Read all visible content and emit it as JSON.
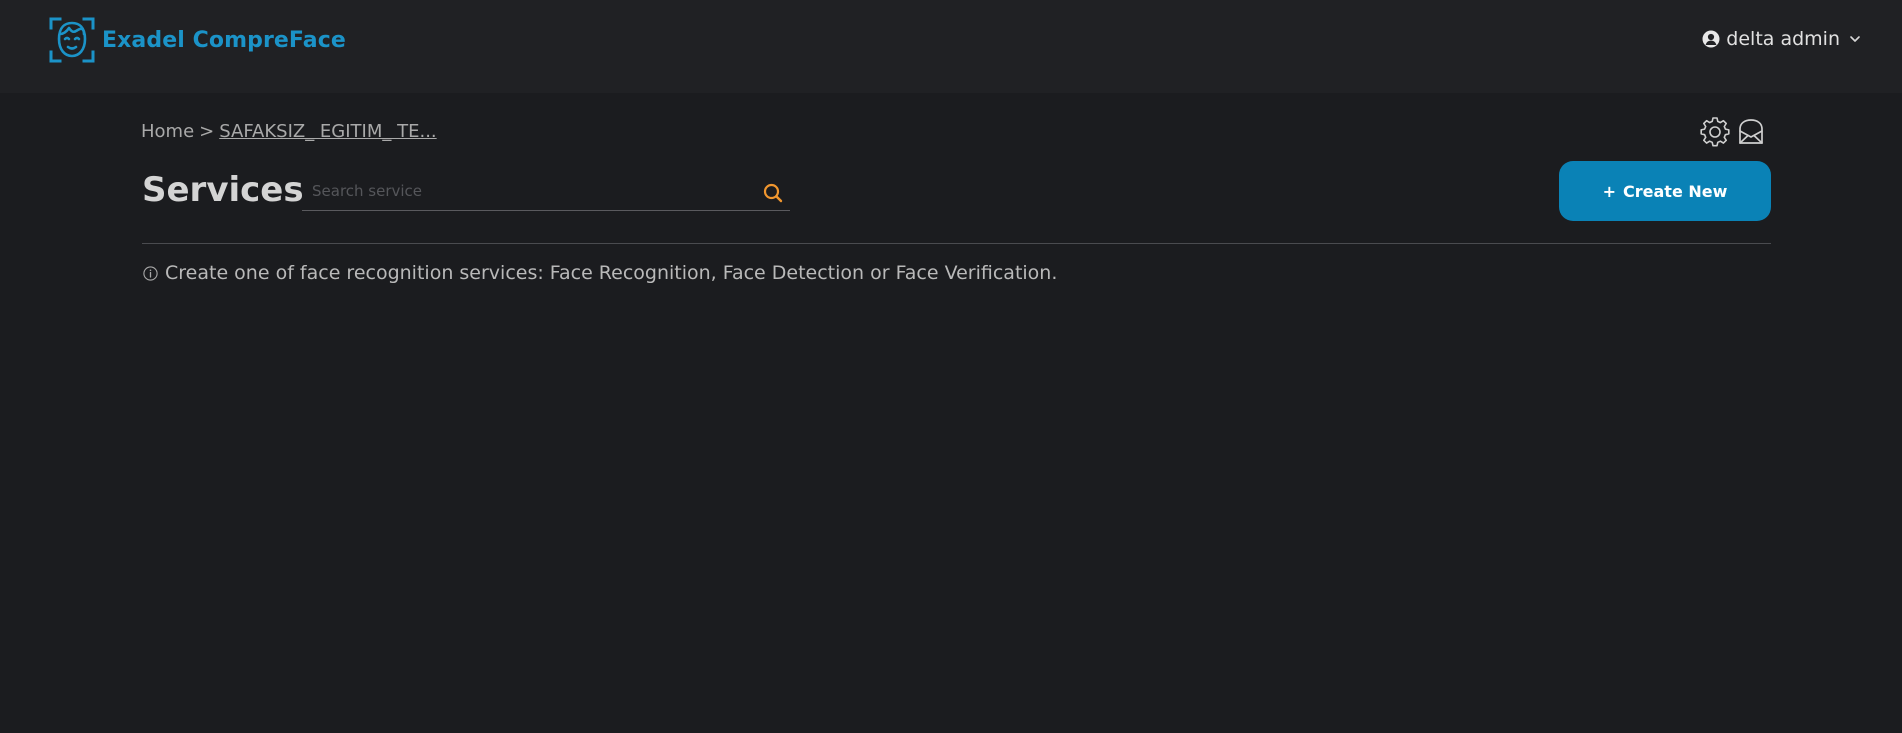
{
  "header": {
    "brand": "Exadel CompreFace",
    "logo_icon": "face-scan-icon",
    "user_name": "delta admin",
    "user_icon": "user-icon",
    "user_menu_icon": "chevron-down-icon"
  },
  "breadcrumb": {
    "home": "Home",
    "separator": ">",
    "current": "SAFAKSIZ_ EGITIM_ TE..."
  },
  "toolbar": {
    "settings_icon": "gear-icon",
    "inbox_icon": "inbox-icon"
  },
  "main": {
    "title": "Services",
    "search": {
      "placeholder": "Search service",
      "value": ""
    },
    "create_button": {
      "plus": "+",
      "label": "Create New"
    },
    "info_text": "Create one of face recognition services: Face Recognition, Face Detection or Face Verification."
  },
  "colors": {
    "background": "#1b1c1f",
    "header_bg": "#202124",
    "brand": "#1b93c8",
    "accent_button": "#0a82b6",
    "search_icon": "#f0962f"
  }
}
